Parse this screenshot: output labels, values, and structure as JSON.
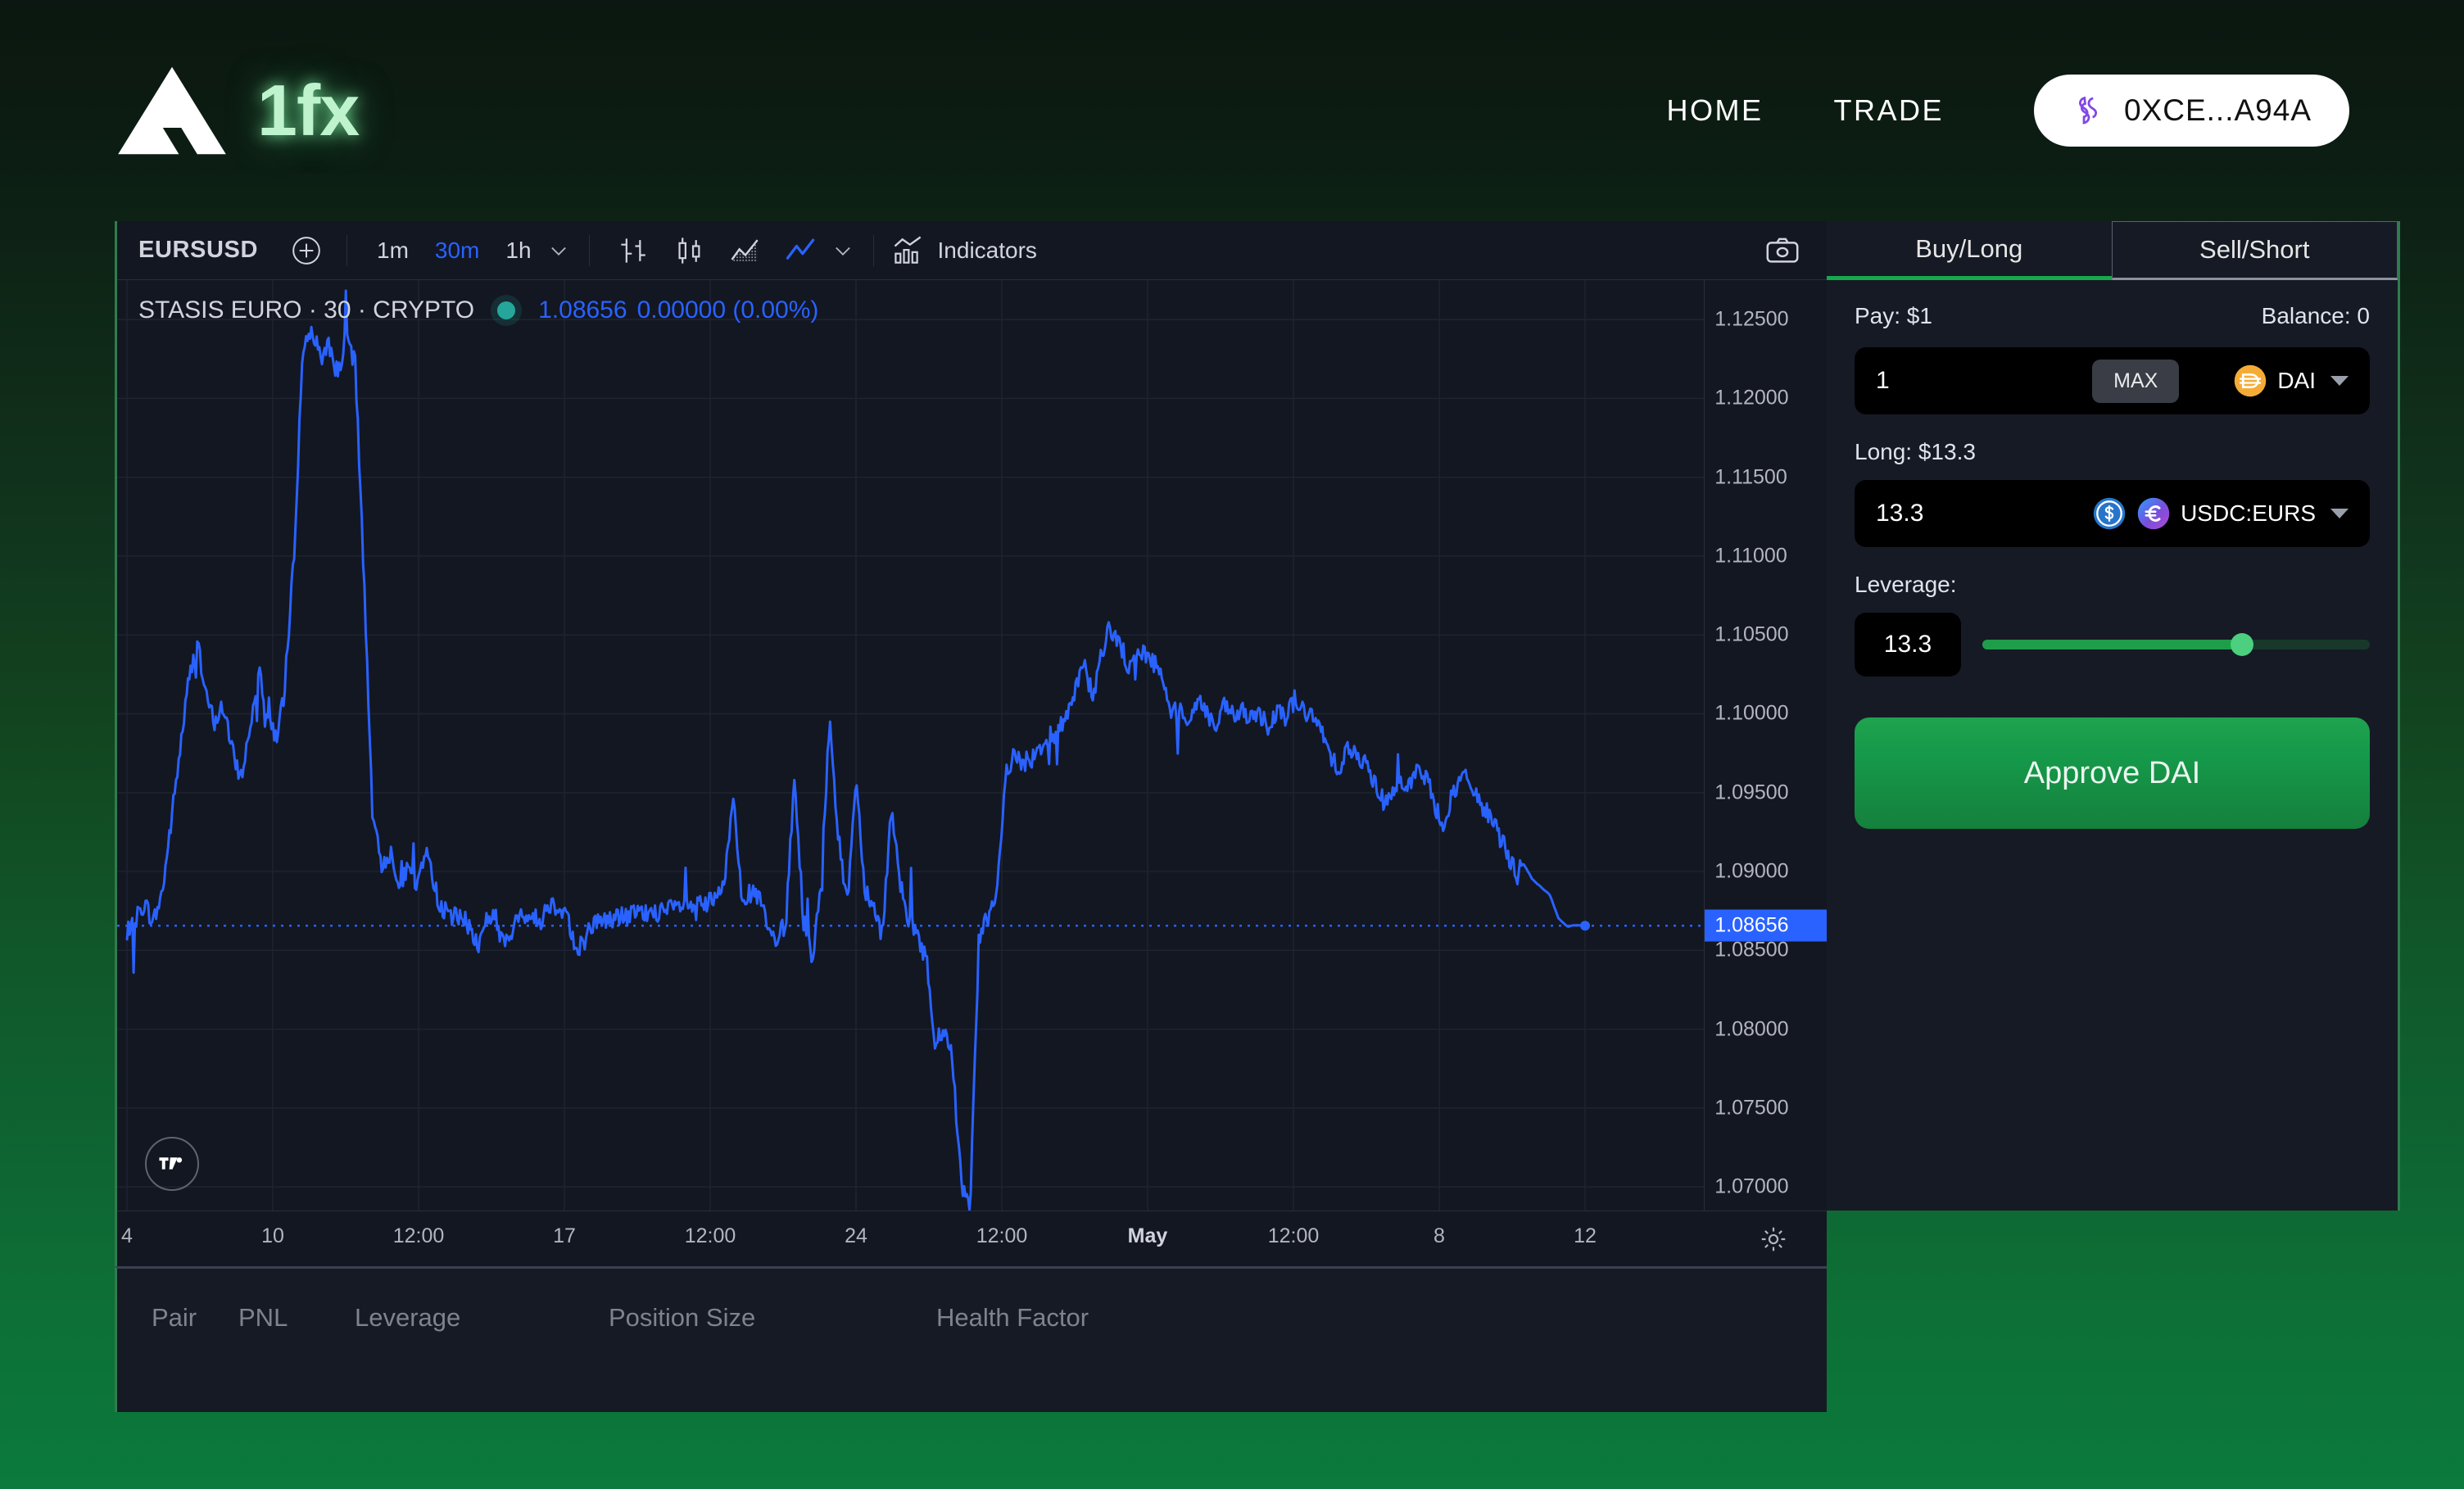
{
  "header": {
    "logo_text": "1fx",
    "logo_icon": "triangle-logo-icon",
    "nav": [
      {
        "label": "HOME",
        "name": "nav-home"
      },
      {
        "label": "TRADE",
        "name": "nav-trade"
      }
    ],
    "wallet": {
      "address": "0XCE...A94A",
      "icon": "polygon-icon",
      "icon_color": "#8247e5",
      "bg": "#ffffff"
    }
  },
  "chart": {
    "toolbar": {
      "symbol": "EURSUSD",
      "add_icon": "plus-circle-icon",
      "timeframes": [
        {
          "label": "1m",
          "active": false
        },
        {
          "label": "30m",
          "active": true
        },
        {
          "label": "1h",
          "active": false
        }
      ],
      "timeframe_chevron": "chevron-down-icon",
      "chart_types": [
        {
          "name": "bar-chart-icon",
          "active": false
        },
        {
          "name": "candlestick-chart-icon",
          "active": false
        },
        {
          "name": "area-chart-icon",
          "active": false
        },
        {
          "name": "line-chart-icon",
          "active": true
        }
      ],
      "charttype_chevron": "chevron-down-icon",
      "indicators_label": "Indicators",
      "indicators_icon": "indicators-icon",
      "camera_icon": "camera-icon",
      "active_color": "#2962ff"
    },
    "legend": {
      "title": "STASIS EURO · 30 · CRYPTO",
      "status_dot_color": "#26a69a",
      "last_price": "1.08656",
      "change": "0.00000",
      "change_pct": "(0.00%)",
      "value_color": "#2962ff"
    },
    "attribution_icon": "tradingview-logo-icon",
    "settings_icon": "gear-icon",
    "current_price_tag": "1.08656"
  },
  "chart_data": {
    "type": "line",
    "title": "STASIS EURO · 30 · CRYPTO",
    "xlabel": "",
    "ylabel": "",
    "series_name": "EURSUSD",
    "line_color": "#2962ff",
    "grid": true,
    "legend_position": "top-left",
    "ylim": [
      1.0685,
      1.1275
    ],
    "y_ticks": [
      "1.12500",
      "1.12000",
      "1.11500",
      "1.11000",
      "1.10500",
      "1.10000",
      "1.09500",
      "1.09000",
      "1.08500",
      "1.08000",
      "1.07500",
      "1.07000"
    ],
    "y_tick_values": [
      1.125,
      1.12,
      1.115,
      1.11,
      1.105,
      1.1,
      1.095,
      1.09,
      1.085,
      1.08,
      1.075,
      1.07
    ],
    "x_ticks": [
      "4",
      "10",
      "12:00",
      "17",
      "12:00",
      "24",
      "12:00",
      "May",
      "12:00",
      "8",
      "12"
    ],
    "x_tick_bold": [
      "May"
    ],
    "price_line": 1.08656,
    "price_line_style": "dotted",
    "last_value": 1.08656,
    "values": [
      1.0855,
      1.087,
      1.088,
      1.0868,
      1.0886,
      1.093,
      1.0975,
      1.102,
      1.1045,
      1.101,
      1.0995,
      1.1005,
      1.0975,
      1.096,
      1.099,
      1.103,
      1.1,
      1.0985,
      1.1015,
      1.11,
      1.123,
      1.1245,
      1.1225,
      1.1235,
      1.1215,
      1.124,
      1.122,
      1.1085,
      1.093,
      1.0905,
      1.0912,
      1.0895,
      1.09,
      1.089,
      1.0915,
      1.089,
      1.0875,
      1.0872,
      1.087,
      1.0866,
      1.0852,
      1.0872,
      1.087,
      1.0852,
      1.0864,
      1.0874,
      1.0872,
      1.0868,
      1.088,
      1.0878,
      1.0876,
      1.085,
      1.0856,
      1.0866,
      1.087,
      1.0869,
      1.0872,
      1.0871,
      1.0874,
      1.0873,
      1.0875,
      1.0874,
      1.0876,
      1.0878,
      1.0877,
      1.088,
      1.0879,
      1.0882,
      1.089,
      1.095,
      1.0886,
      1.0885,
      1.0884,
      1.0862,
      1.0855,
      1.0868,
      1.096,
      1.087,
      1.0845,
      1.089,
      1.1,
      1.092,
      1.088,
      1.096,
      1.089,
      1.0878,
      1.086,
      1.094,
      1.0895,
      1.087,
      1.086,
      1.0845,
      1.079,
      1.08,
      1.078,
      1.07,
      1.069,
      1.086,
      1.087,
      1.088,
      1.096,
      1.0975,
      1.0968,
      1.0972,
      1.098,
      1.0985,
      1.099,
      1.1,
      1.1015,
      1.103,
      1.101,
      1.104,
      1.1055,
      1.1045,
      1.103,
      1.104,
      1.1038,
      1.1032,
      1.102,
      1.1,
      1.1005,
      1.0995,
      1.101,
      1.1,
      1.099,
      1.1005,
      1.0998,
      1.1002,
      1.0995,
      1.1,
      1.0992,
      1.1005,
      1.0998,
      1.101,
      1.1002,
      1.0996,
      1.099,
      1.0975,
      1.0965,
      1.098,
      1.0972,
      1.0968,
      1.0958,
      1.0945,
      1.095,
      1.096,
      1.0955,
      1.0965,
      1.0958,
      1.094,
      1.093,
      1.095,
      1.096,
      1.0955,
      1.0945,
      1.0935,
      1.0925,
      1.0915,
      1.09,
      1.0905,
      1.0895,
      1.089,
      1.0885,
      1.087,
      1.0865,
      1.0866,
      1.08656
    ]
  },
  "trade": {
    "tabs": [
      {
        "label": "Buy/Long",
        "active": true
      },
      {
        "label": "Sell/Short",
        "active": false
      }
    ],
    "pay_label": "Pay: $1",
    "balance_label": "Balance: 0",
    "pay_amount": "1",
    "max_label": "MAX",
    "pay_token": "DAI",
    "pay_token_icon": "dai-coin-icon",
    "pay_token_color": "#f5ac37",
    "long_label": "Long: $13.3",
    "long_amount": "13.3",
    "market_pair": "USDC:EURS",
    "market_icons": [
      "usdc-coin-icon",
      "eurs-coin-icon"
    ],
    "leverage_label": "Leverage:",
    "leverage_value": "13.3",
    "leverage_percent": 67,
    "slider_color": "#1e9e4a",
    "approve_label": "Approve DAI",
    "approve_color": "#16a34a",
    "dropdown_icon": "caret-down-icon"
  },
  "positions": {
    "columns": [
      "Pair",
      "PNL",
      "Leverage",
      "Position Size",
      "Health Factor"
    ],
    "rows": []
  }
}
